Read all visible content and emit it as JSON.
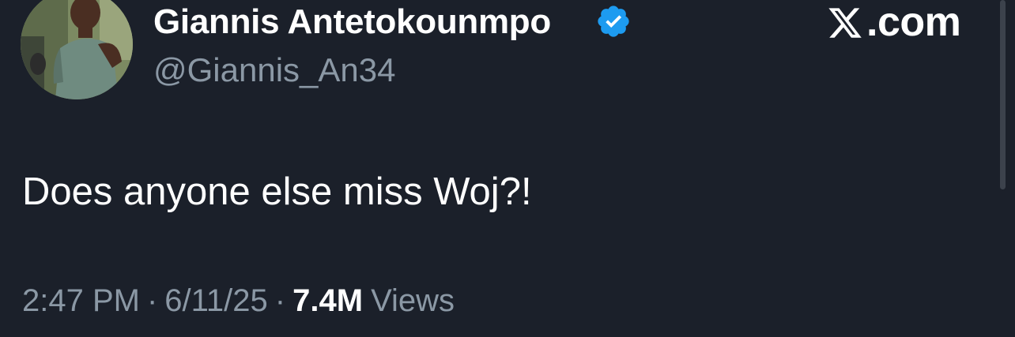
{
  "author": {
    "display_name": "Giannis Antetokounmpo",
    "handle": "@Giannis_An34",
    "verified": true,
    "verified_color": "#1d9bf0",
    "avatar_icon": "profile-photo"
  },
  "watermark": {
    "text": ".com",
    "icon": "x-logo-icon"
  },
  "tweet": {
    "text": "Does anyone else miss Woj?!"
  },
  "meta": {
    "time": "2:47 PM",
    "separator": "·",
    "date": "6/11/25",
    "views_count": "7.4M",
    "views_label": "Views"
  },
  "colors": {
    "background": "#1b202a",
    "primary_text": "#ffffff",
    "secondary_text": "#8b98a5"
  }
}
